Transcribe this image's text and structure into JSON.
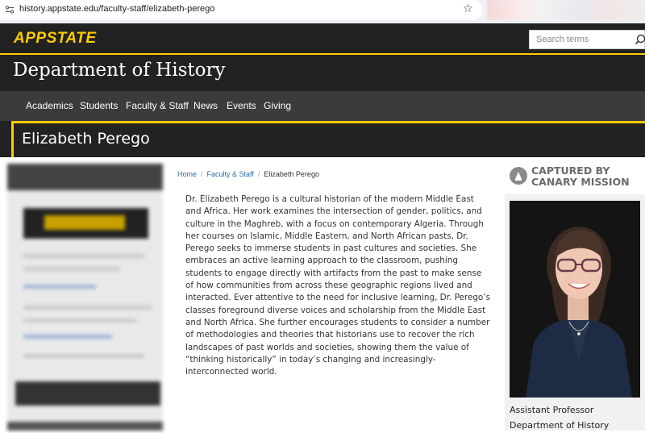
{
  "browser": {
    "url": "history.appstate.edu/faculty-staff/elizabeth-perego"
  },
  "header": {
    "logo_text": "APPSTATE",
    "search_placeholder": "Search terms"
  },
  "department": {
    "title": "Department of History"
  },
  "nav": {
    "items": [
      "Academics",
      "Students",
      "Faculty & Staff",
      "News",
      "Events",
      "Giving"
    ]
  },
  "page": {
    "title": "Elizabeth Perego"
  },
  "breadcrumb": {
    "items": [
      "Home",
      "Faculty & Staff",
      "Elizabeth Perego"
    ]
  },
  "bio": {
    "text": "Dr. Elizabeth Perego is a cultural historian of the modern Middle East and Africa. Her work examines the intersection of gender, politics, and culture in the Maghreb, with a focus on contemporary Algeria. Through her courses on Islamic, Middle Eastern, and North African pasts, Dr. Perego seeks to immerse students in past cultures and societies. She embraces an active learning approach to the classroom, pushing students to engage directly with artifacts from the past to make sense of how communities from across these geographic regions lived and interacted. Ever attentive to the need for inclusive learning, Dr. Perego’s classes foreground diverse voices and scholarship from the Middle East and North Africa. She further encourages students to consider a number of methodologies and theories that historians use to recover the rich landscapes of past worlds and societies, showing them the value of “thinking historically” in today’s changing and increasingly-interconnected world."
  },
  "watermark": {
    "line1": "CAPTURED BY",
    "line2": "CANARY MISSION"
  },
  "profile": {
    "role": "Assistant Professor",
    "department": "Department of History"
  },
  "colors": {
    "brand_gold": "#ffcc00",
    "header_dark": "#222222",
    "nav_gray": "#3b3b3b",
    "link_blue": "#2a6ea8"
  },
  "icons": [
    "site-info-icon",
    "bookmark-star-icon",
    "search-icon",
    "canary-logo-icon"
  ]
}
